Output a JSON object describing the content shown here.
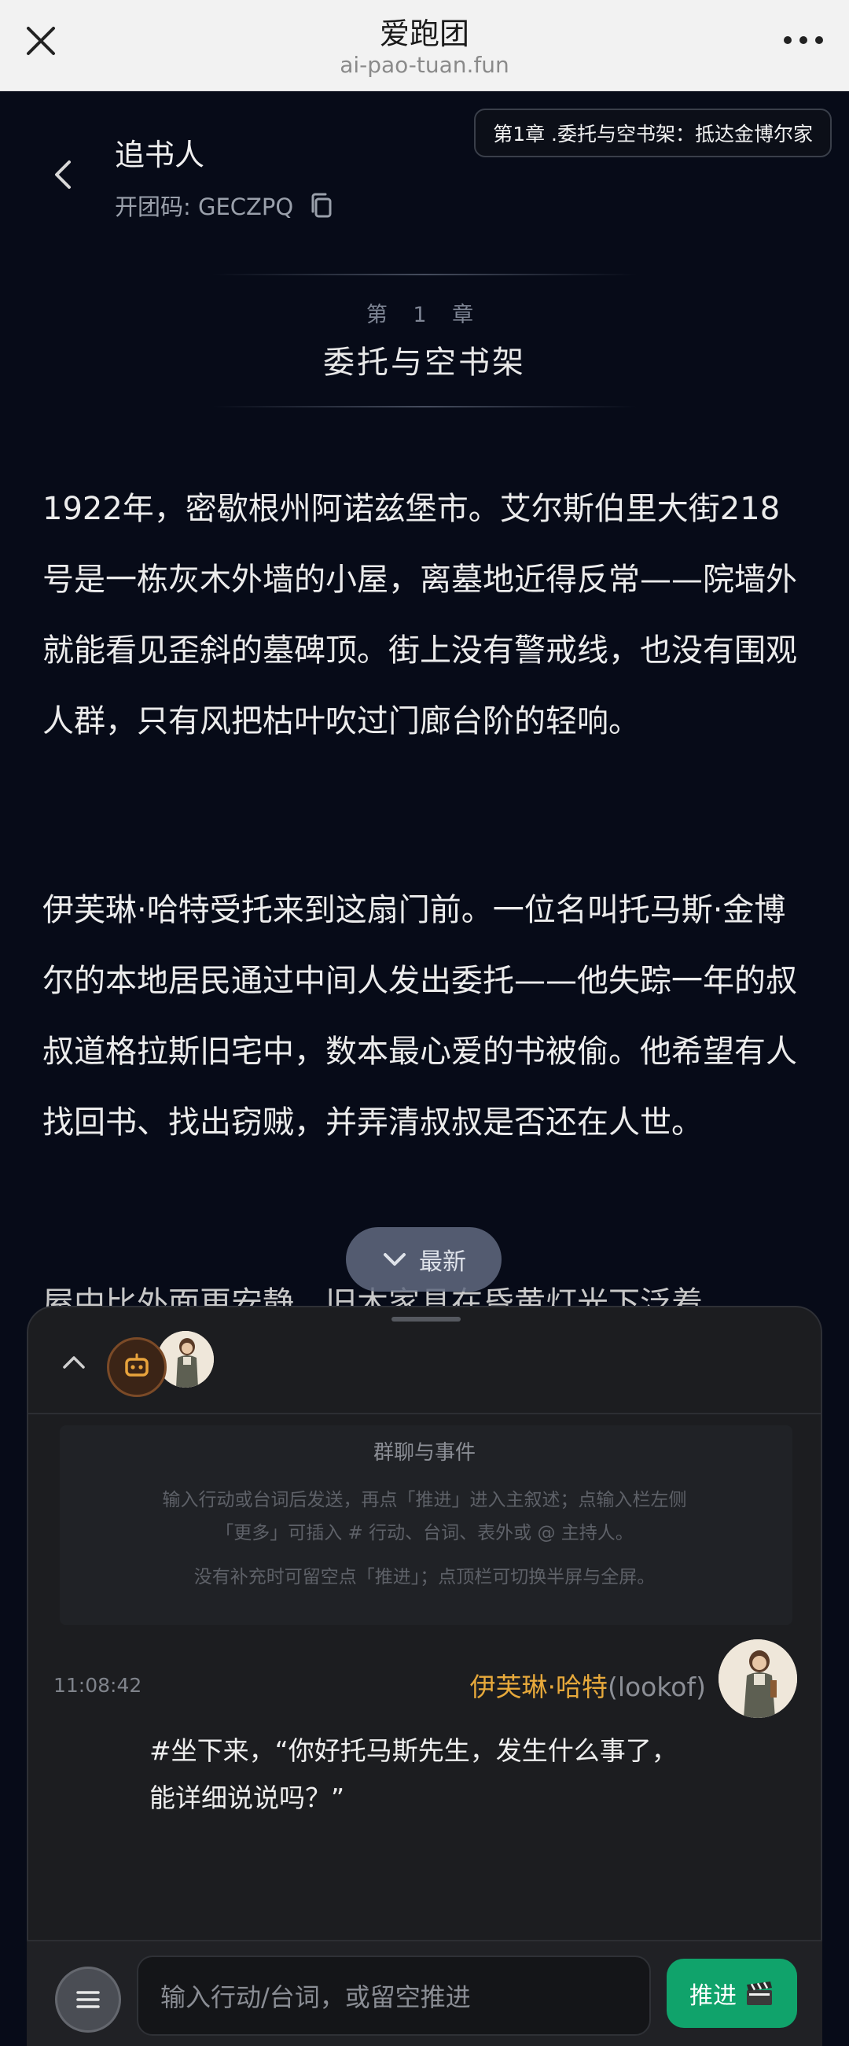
{
  "browser": {
    "title": "爱跑团",
    "url": "ai-pao-tuan.fun"
  },
  "header": {
    "book_title": "追书人",
    "group_code": "开团码: GECZPQ",
    "chapter_badge": "第1章 .委托与空书架：抵达金博尔家"
  },
  "chapter": {
    "number": "第 1 章",
    "name": "委托与空书架"
  },
  "story": {
    "paragraphs": [
      "1922年，密歇根州阿诺兹堡市。艾尔斯伯里大街218号是一栋灰木外墙的小屋，离墓地近得反常——院墙外就能看见歪斜的墓碑顶。街上没有警戒线，也没有围观人群，只有风把枯叶吹过门廊台阶的轻响。",
      "伊芙琳·哈特受托来到这扇门前。一位名叫托马斯·金博尔的本地居民通过中间人发出委托——他失踪一年的叔叔道格拉斯旧宅中，数本最心爱的书被偷。他希望有人找回书、找出窃贼，并弄清叔叔是否还在人世。",
      "屋中比外面更安静，旧木家具在昏黄灯光下泛着"
    ],
    "newest_label": "最新"
  },
  "chat": {
    "system_title": "群聊与事件",
    "system_hint_1": "输入行动或台词后发送，再点「推进」进入主叙述；点输入栏左侧「更多」可插入 # 行动、台词、表外或 @ 主持人。",
    "system_hint_2": "没有补充时可留空点「推进」；点顶栏可切换半屏与全屏。",
    "message": {
      "time": "11:08:42",
      "sender_name": "伊芙琳·哈特",
      "sender_id": "(lookof)",
      "text": "#坐下来，“你好托马斯先生，发生什么事了，能详细说说吗？”"
    }
  },
  "input": {
    "placeholder": "输入行动/台词，或留空推进",
    "push_label": "推进"
  },
  "colors": {
    "background": "#070b18",
    "accent_name": "#e7a93b",
    "push_button": "#10a36b"
  },
  "icons": [
    "close-icon",
    "more-icon",
    "back-icon",
    "copy-icon",
    "chevron-down-icon",
    "chevron-up-icon",
    "robot-icon",
    "menu-icon",
    "clapperboard-icon"
  ]
}
